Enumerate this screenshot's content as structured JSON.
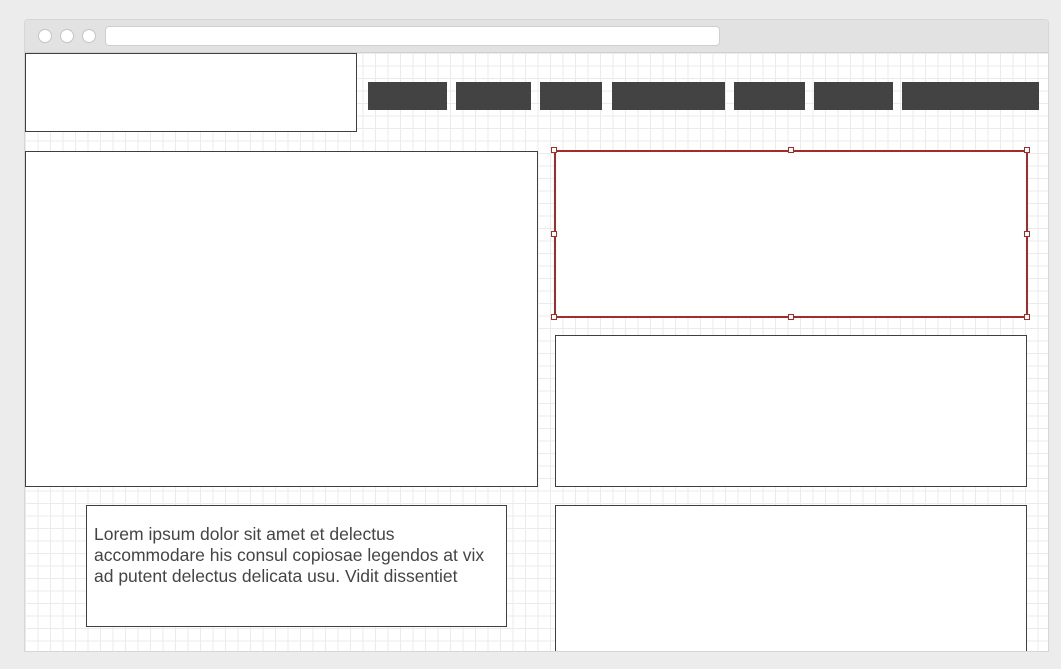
{
  "window": {
    "controls": [
      "close-icon",
      "minimize-icon",
      "maximize-icon"
    ],
    "url": ""
  },
  "wireframe": {
    "nav_item_count": 7,
    "text_block": "Lorem ipsum dolor sit amet et delectus accommodare his consul copiosae legendos at vix ad putent delectus delicata usu. Vidit dissentiet"
  },
  "colors": {
    "nav_button": "#434343",
    "selection": "#a52a2a",
    "grid": "#ebebeb",
    "text": "#444444"
  }
}
